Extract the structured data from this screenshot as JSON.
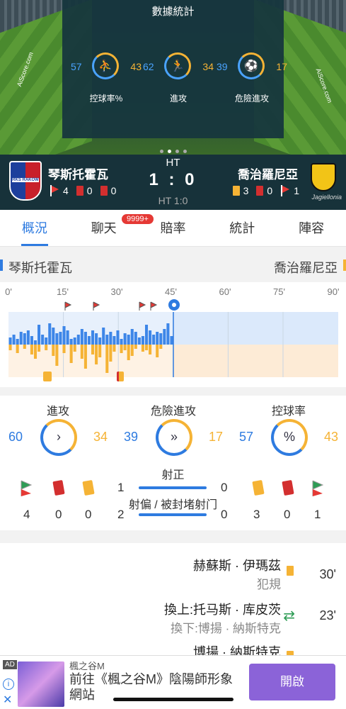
{
  "stats_panel": {
    "title": "數據統計",
    "items": [
      {
        "label": "控球率%",
        "home": "57",
        "away": "43"
      },
      {
        "label": "進攻",
        "home": "62",
        "away": "34"
      },
      {
        "label": "危險進攻",
        "home": "39",
        "away": "17"
      }
    ],
    "watermark": "AiScore.com"
  },
  "match": {
    "home": {
      "name": "琴斯托霍瓦",
      "corners": "4",
      "red": "0",
      "yellow": "0",
      "logo_text": "RKS RAKOW"
    },
    "away": {
      "name": "喬治羅尼亞",
      "yellow": "3",
      "red": "0",
      "corners": "1",
      "logo_text": "Jagiellonia"
    },
    "status": "HT",
    "score": "1 : 0",
    "ht_score": "HT 1:0"
  },
  "tabs": [
    "概況",
    "聊天",
    "賠率",
    "統計",
    "陣容"
  ],
  "chat_badge": "9999+",
  "timeline": {
    "home": "琴斯托霍瓦",
    "away": "喬治羅尼亞",
    "minutes": [
      "0'",
      "15'",
      "30'",
      "45'",
      "60'",
      "75'",
      "90'"
    ],
    "home_bars": [
      10,
      14,
      8,
      18,
      16,
      20,
      12,
      6,
      28,
      14,
      10,
      30,
      24,
      16,
      18,
      26,
      20,
      8,
      10,
      14,
      22,
      18,
      12,
      20,
      16,
      10,
      24,
      14,
      18,
      12,
      20,
      8,
      16,
      14,
      22,
      18,
      10,
      12,
      28,
      20,
      14,
      18,
      16,
      22,
      30,
      12
    ],
    "away_bars": [
      8,
      0,
      12,
      0,
      6,
      0,
      14,
      20,
      10,
      0,
      8,
      0,
      16,
      30,
      0,
      12,
      0,
      26,
      10,
      0,
      20,
      34,
      0,
      14,
      28,
      18,
      0,
      40,
      24,
      10,
      0,
      12,
      8,
      22,
      16,
      6,
      0,
      10,
      8,
      14,
      0,
      18,
      6,
      0,
      0,
      0
    ]
  },
  "stats": {
    "ring_stats": [
      {
        "label": "進攻",
        "home": "60",
        "away": "34",
        "symbol": "›"
      },
      {
        "label": "危險進攻",
        "home": "39",
        "away": "17",
        "symbol": "»"
      },
      {
        "label": "控球率",
        "home": "57",
        "away": "43",
        "symbol": "%"
      }
    ],
    "on_target_label": "射正",
    "on_target_home": "1",
    "on_target_away": "0",
    "off_target_label": "射偏 / 被封堵射门",
    "off_target_home": "2",
    "off_target_away": "0",
    "home_counts": {
      "corners": "4",
      "red": "0",
      "yellow": "0"
    },
    "away_counts": {
      "yellow": "3",
      "red": "0",
      "corners": "1"
    }
  },
  "events": [
    {
      "line1": "赫蘇斯 · 伊瑪茲",
      "line2": "犯規",
      "minute": "30'",
      "type": "yellow-card"
    },
    {
      "line1": "換上:托马斯 · 库皮茨",
      "line2": "換下:博揚 · 納斯特克",
      "minute": "23'",
      "type": "substitution"
    },
    {
      "line1": "博揚 · 納斯特克",
      "line2": "",
      "minute": "",
      "type": "yellow-card"
    }
  ],
  "ad": {
    "tag": "AD",
    "brand": "楓之谷M",
    "title": "前往《楓之谷M》陰陽師形象網站",
    "button": "開啟"
  }
}
